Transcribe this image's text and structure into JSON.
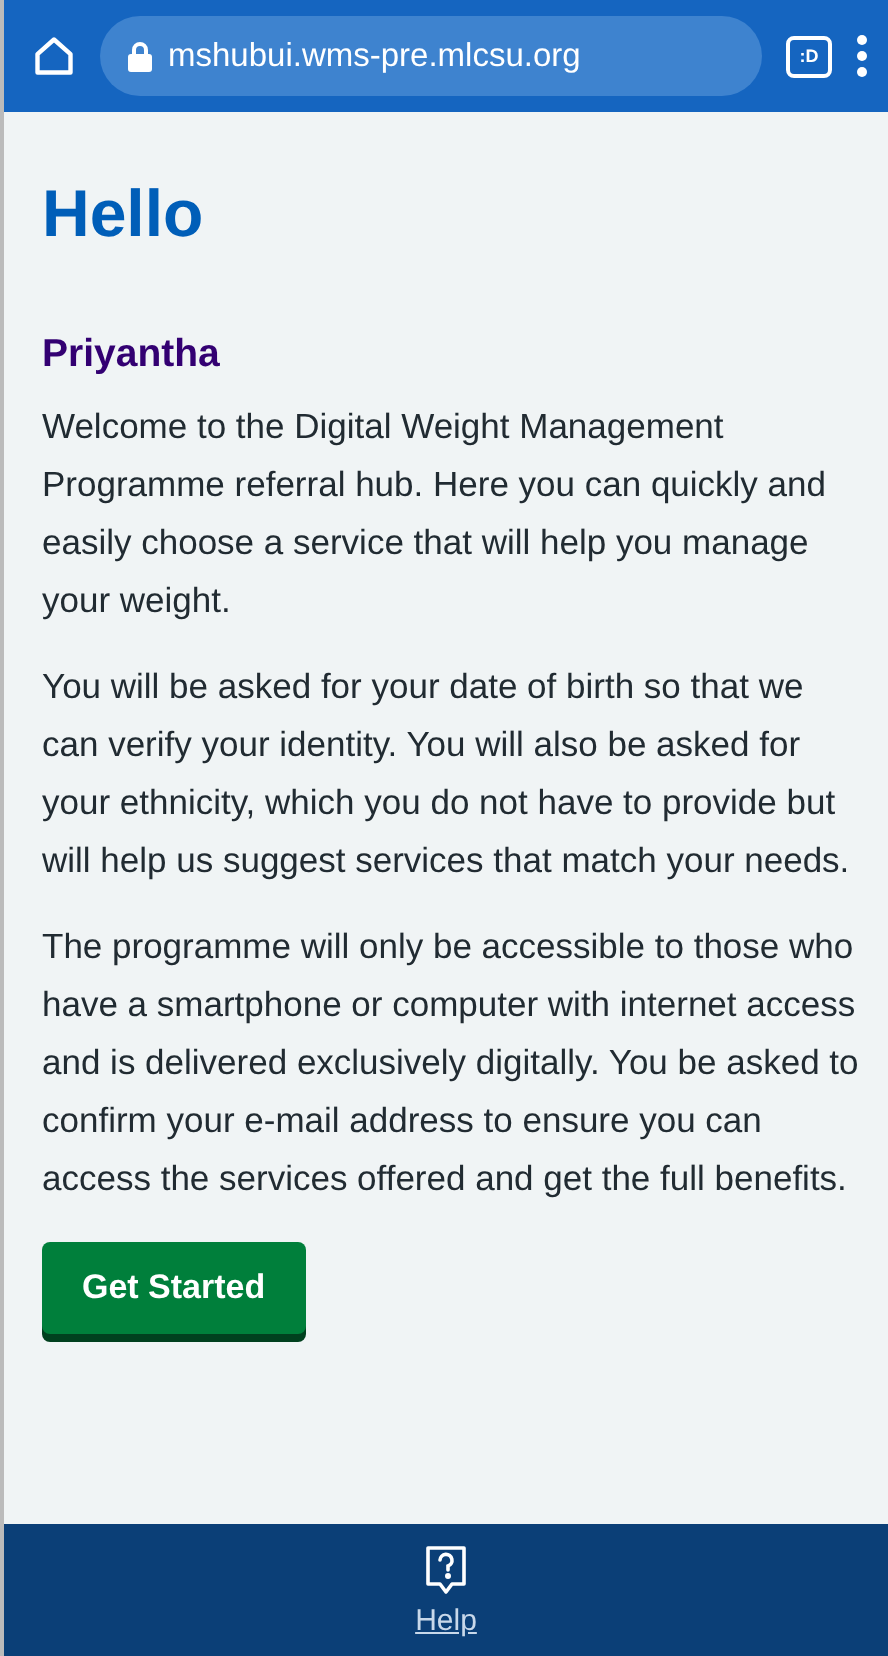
{
  "browser_bar": {
    "url": "mshubui.wms-pre.mlcsu.org",
    "tab_count": ":D"
  },
  "heading": "Hello",
  "user_name": "Priyantha",
  "paragraphs": [
    "Welcome to the Digital Weight Management Programme referral hub. Here you can quickly and easily choose a service that will help you manage your weight.",
    "You will be asked for your date of birth so that we can verify your identity. You will also be asked for your ethnicity, which you do not have to provide but will help us suggest services that match your needs.",
    "The programme will only be accessible to those who have a smartphone or computer with internet access and is delivered exclusively digitally. You be asked to confirm your e-mail address to ensure you can access the services offered and get the full benefits."
  ],
  "primary_button": "Get Started",
  "footer": {
    "help_link": "Help"
  }
}
